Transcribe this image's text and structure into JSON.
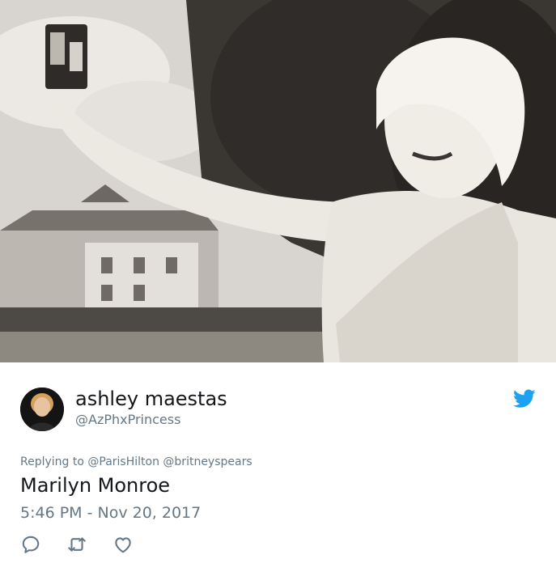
{
  "tweet": {
    "author_name": "ashley maestas",
    "author_handle": "@AzPhxPrincess",
    "replying_prefix": "Replying to",
    "replying_to": [
      "@ParisHilton",
      "@britneyspears"
    ],
    "text": "Marilyn Monroe",
    "timestamp": "5:46 PM - Nov 20, 2017"
  },
  "icons": {
    "brand": "twitter-bird-icon",
    "reply": "reply-icon",
    "retweet": "retweet-icon",
    "like": "heart-icon"
  },
  "colors": {
    "twitter_blue": "#1da1f2",
    "secondary_text": "#657786",
    "primary_text": "#14171a"
  }
}
